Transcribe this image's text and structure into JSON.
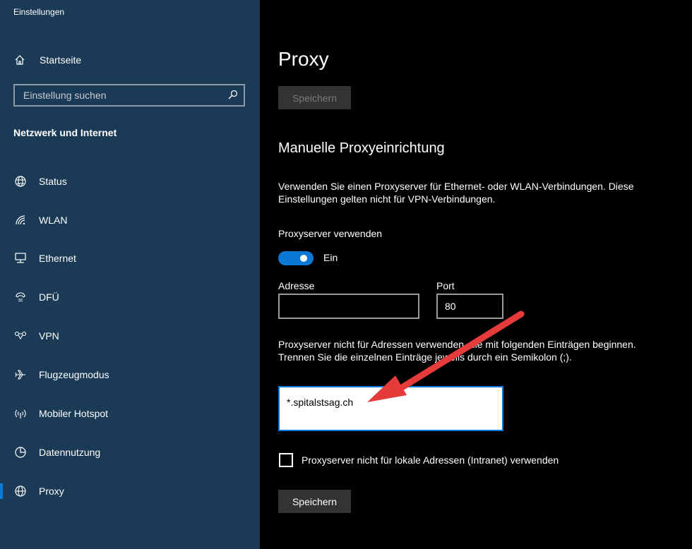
{
  "window": {
    "title": "Einstellungen"
  },
  "sidebar": {
    "home_label": "Startseite",
    "search_placeholder": "Einstellung suchen",
    "section_title": "Netzwerk und Internet",
    "items": [
      {
        "label": "Status",
        "icon": "globe-status-icon",
        "selected": false
      },
      {
        "label": "WLAN",
        "icon": "wifi-icon",
        "selected": false
      },
      {
        "label": "Ethernet",
        "icon": "ethernet-icon",
        "selected": false
      },
      {
        "label": "DFÜ",
        "icon": "dialup-icon",
        "selected": false
      },
      {
        "label": "VPN",
        "icon": "vpn-icon",
        "selected": false
      },
      {
        "label": "Flugzeugmodus",
        "icon": "airplane-icon",
        "selected": false
      },
      {
        "label": "Mobiler Hotspot",
        "icon": "hotspot-icon",
        "selected": false
      },
      {
        "label": "Datennutzung",
        "icon": "data-usage-icon",
        "selected": false
      },
      {
        "label": "Proxy",
        "icon": "globe-icon",
        "selected": true
      }
    ]
  },
  "main": {
    "title": "Proxy",
    "top_save_label": "Speichern",
    "section_heading": "Manuelle Proxyeinrichtung",
    "description": "Verwenden Sie einen Proxyserver für Ethernet- oder WLAN-Verbindungen. Diese Einstellungen gelten nicht für VPN-Verbindungen.",
    "use_proxy_label": "Proxyserver verwenden",
    "toggle_state": "Ein",
    "address_label": "Adresse",
    "address_value": "",
    "port_label": "Port",
    "port_value": "80",
    "exceptions_text": "Proxyserver nicht für Adressen verwenden, die mit folgenden Einträgen beginnen. Trennen Sie die einzelnen Einträge jeweils durch ein Semikolon (;).",
    "exceptions_value": "*.spitalstsag.ch",
    "local_checkbox_label": "Proxyserver nicht für lokale Adressen (Intranet) verwenden",
    "bottom_save_label": "Speichern"
  },
  "colors": {
    "sidebar_bg": "#1b3a55",
    "accent": "#0a78d7",
    "annotation_arrow": "#e63b3b"
  }
}
